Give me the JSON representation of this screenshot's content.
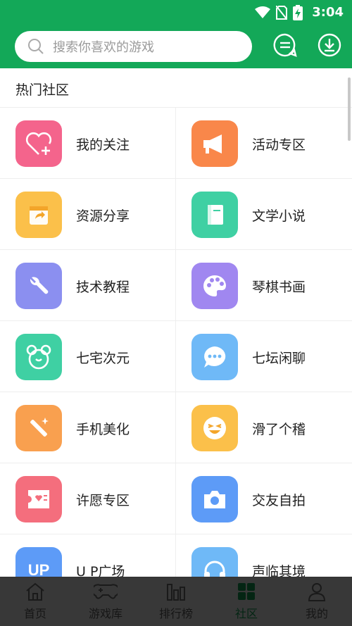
{
  "status_bar": {
    "time": "3:04"
  },
  "search": {
    "placeholder": "搜索你喜欢的游戏"
  },
  "section": {
    "title": "热门社区"
  },
  "communities": [
    {
      "label": "我的关注",
      "color": "#f4648c",
      "icon": "heart-plus-icon"
    },
    {
      "label": "活动专区",
      "color": "#f9874a",
      "icon": "megaphone-icon"
    },
    {
      "label": "资源分享",
      "color": "#fbc04a",
      "icon": "share-box-icon"
    },
    {
      "label": "文学小说",
      "color": "#3fd0a3",
      "icon": "book-icon"
    },
    {
      "label": "技术教程",
      "color": "#8b8ff0",
      "icon": "wrench-icon"
    },
    {
      "label": "琴棋书画",
      "color": "#a087f0",
      "icon": "palette-icon"
    },
    {
      "label": "七宅次元",
      "color": "#3fd0a3",
      "icon": "bear-icon"
    },
    {
      "label": "七坛闲聊",
      "color": "#6fb9f7",
      "icon": "chat-bubble-icon"
    },
    {
      "label": "手机美化",
      "color": "#f9a04f",
      "icon": "magic-wand-icon"
    },
    {
      "label": "滑了个稽",
      "color": "#fbc04a",
      "icon": "laughing-face-icon"
    },
    {
      "label": "许愿专区",
      "color": "#f46e7d",
      "icon": "wish-card-icon"
    },
    {
      "label": "交友自拍",
      "color": "#5d9bf7",
      "icon": "camera-icon"
    },
    {
      "label": "U P广场",
      "color": "#5d9bf7",
      "icon": "up-badge-icon",
      "badge": "UP"
    },
    {
      "label": "声临其境",
      "color": "#6fb9f7",
      "icon": "headphones-icon"
    }
  ],
  "tabs": [
    {
      "label": "首页",
      "icon": "home-icon",
      "active": false
    },
    {
      "label": "游戏库",
      "icon": "gamepad-icon",
      "active": false
    },
    {
      "label": "排行榜",
      "icon": "bar-chart-icon",
      "active": false
    },
    {
      "label": "社区",
      "icon": "grid-icon",
      "active": true
    },
    {
      "label": "我的",
      "icon": "person-icon",
      "active": false
    }
  ],
  "colors": {
    "brand": "#13a858"
  }
}
